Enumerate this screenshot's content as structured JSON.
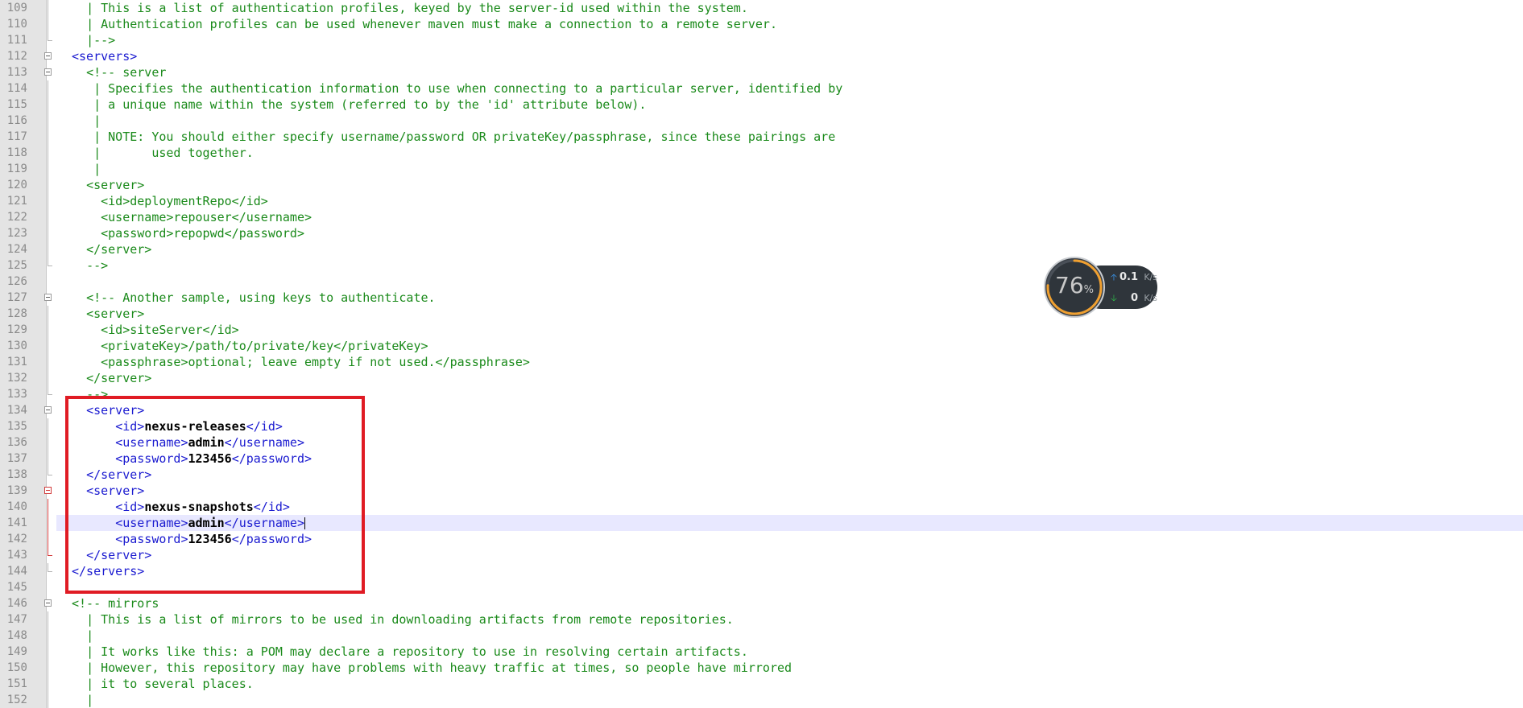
{
  "editor": {
    "current_line": 141,
    "lines": [
      {
        "n": "109",
        "indent": "  ",
        "parts": [
          {
            "t": "| This is a list of authentication profiles, keyed by the server-id used within the system.",
            "c": "cm"
          }
        ]
      },
      {
        "n": "110",
        "indent": "  ",
        "parts": [
          {
            "t": "| Authentication profiles can be used whenever maven must make a connection to a remote server.",
            "c": "cm"
          }
        ]
      },
      {
        "n": "111",
        "indent": "  ",
        "parts": [
          {
            "t": "|-->",
            "c": "cm"
          }
        ]
      },
      {
        "n": "112",
        "indent": "",
        "parts": [
          {
            "t": "<servers>",
            "c": "tg"
          }
        ]
      },
      {
        "n": "113",
        "indent": "  ",
        "parts": [
          {
            "t": "<!-- server",
            "c": "cm"
          }
        ]
      },
      {
        "n": "114",
        "indent": "   ",
        "parts": [
          {
            "t": "| Specifies the authentication information to use when connecting to a particular server, identified by",
            "c": "cm"
          }
        ]
      },
      {
        "n": "115",
        "indent": "   ",
        "parts": [
          {
            "t": "| a unique name within the system (referred to by the 'id' attribute below).",
            "c": "cm"
          }
        ]
      },
      {
        "n": "116",
        "indent": "   ",
        "parts": [
          {
            "t": "|",
            "c": "cm"
          }
        ]
      },
      {
        "n": "117",
        "indent": "   ",
        "parts": [
          {
            "t": "| NOTE: You should either specify username/password OR privateKey/passphrase, since these pairings are",
            "c": "cm"
          }
        ]
      },
      {
        "n": "118",
        "indent": "   ",
        "parts": [
          {
            "t": "|       used together.",
            "c": "cm"
          }
        ]
      },
      {
        "n": "119",
        "indent": "   ",
        "parts": [
          {
            "t": "|",
            "c": "cm"
          }
        ]
      },
      {
        "n": "120",
        "indent": "  ",
        "parts": [
          {
            "t": "<server>",
            "c": "cm"
          }
        ]
      },
      {
        "n": "121",
        "indent": "    ",
        "parts": [
          {
            "t": "<id>deploymentRepo</id>",
            "c": "cm"
          }
        ]
      },
      {
        "n": "122",
        "indent": "    ",
        "parts": [
          {
            "t": "<username>repouser</username>",
            "c": "cm"
          }
        ]
      },
      {
        "n": "123",
        "indent": "    ",
        "parts": [
          {
            "t": "<password>repopwd</password>",
            "c": "cm"
          }
        ]
      },
      {
        "n": "124",
        "indent": "  ",
        "parts": [
          {
            "t": "</server>",
            "c": "cm"
          }
        ]
      },
      {
        "n": "125",
        "indent": "  ",
        "parts": [
          {
            "t": "-->",
            "c": "cm"
          }
        ]
      },
      {
        "n": "126",
        "indent": "",
        "parts": []
      },
      {
        "n": "127",
        "indent": "  ",
        "parts": [
          {
            "t": "<!-- Another sample, using keys to authenticate.",
            "c": "cm"
          }
        ]
      },
      {
        "n": "128",
        "indent": "  ",
        "parts": [
          {
            "t": "<server>",
            "c": "cm"
          }
        ]
      },
      {
        "n": "129",
        "indent": "    ",
        "parts": [
          {
            "t": "<id>siteServer</id>",
            "c": "cm"
          }
        ]
      },
      {
        "n": "130",
        "indent": "    ",
        "parts": [
          {
            "t": "<privateKey>/path/to/private/key</privateKey>",
            "c": "cm"
          }
        ]
      },
      {
        "n": "131",
        "indent": "    ",
        "parts": [
          {
            "t": "<passphrase>optional; leave empty if not used.</passphrase>",
            "c": "cm"
          }
        ]
      },
      {
        "n": "132",
        "indent": "  ",
        "parts": [
          {
            "t": "</server>",
            "c": "cm"
          }
        ]
      },
      {
        "n": "133",
        "indent": "  ",
        "parts": [
          {
            "t": "-->",
            "c": "cm"
          }
        ]
      },
      {
        "n": "134",
        "indent": "  ",
        "parts": [
          {
            "t": "<server>",
            "c": "tg"
          }
        ]
      },
      {
        "n": "135",
        "indent": "      ",
        "parts": [
          {
            "t": "<id>",
            "c": "tg"
          },
          {
            "t": "nexus-releases",
            "c": "tx"
          },
          {
            "t": "</id>",
            "c": "tg"
          }
        ]
      },
      {
        "n": "136",
        "indent": "      ",
        "parts": [
          {
            "t": "<username>",
            "c": "tg"
          },
          {
            "t": "admin",
            "c": "tx"
          },
          {
            "t": "</username>",
            "c": "tg"
          }
        ]
      },
      {
        "n": "137",
        "indent": "      ",
        "parts": [
          {
            "t": "<password>",
            "c": "tg"
          },
          {
            "t": "123456",
            "c": "tx"
          },
          {
            "t": "</password>",
            "c": "tg"
          }
        ]
      },
      {
        "n": "138",
        "indent": "  ",
        "parts": [
          {
            "t": "</server>",
            "c": "tg"
          }
        ]
      },
      {
        "n": "139",
        "indent": "  ",
        "parts": [
          {
            "t": "<server>",
            "c": "tg"
          }
        ]
      },
      {
        "n": "140",
        "indent": "      ",
        "parts": [
          {
            "t": "<id>",
            "c": "tg"
          },
          {
            "t": "nexus-snapshots",
            "c": "tx"
          },
          {
            "t": "</id>",
            "c": "tg"
          }
        ]
      },
      {
        "n": "141",
        "indent": "      ",
        "parts": [
          {
            "t": "<username>",
            "c": "tg"
          },
          {
            "t": "admin",
            "c": "tx"
          },
          {
            "t": "</username>",
            "c": "tg"
          }
        ]
      },
      {
        "n": "142",
        "indent": "      ",
        "parts": [
          {
            "t": "<password>",
            "c": "tg"
          },
          {
            "t": "123456",
            "c": "tx"
          },
          {
            "t": "</password>",
            "c": "tg"
          }
        ]
      },
      {
        "n": "143",
        "indent": "  ",
        "parts": [
          {
            "t": "</server>",
            "c": "tg"
          }
        ]
      },
      {
        "n": "144",
        "indent": "",
        "parts": [
          {
            "t": "</servers>",
            "c": "tg"
          }
        ]
      },
      {
        "n": "145",
        "indent": "",
        "parts": []
      },
      {
        "n": "146",
        "indent": "",
        "parts": [
          {
            "t": "<!-- mirrors",
            "c": "cm"
          }
        ]
      },
      {
        "n": "147",
        "indent": "  ",
        "parts": [
          {
            "t": "| This is a list of mirrors to be used in downloading artifacts from remote repositories.",
            "c": "cm"
          }
        ]
      },
      {
        "n": "148",
        "indent": "  ",
        "parts": [
          {
            "t": "|",
            "c": "cm"
          }
        ]
      },
      {
        "n": "149",
        "indent": "  ",
        "parts": [
          {
            "t": "| It works like this: a POM may declare a repository to use in resolving certain artifacts.",
            "c": "cm"
          }
        ]
      },
      {
        "n": "150",
        "indent": "  ",
        "parts": [
          {
            "t": "| However, this repository may have problems with heavy traffic at times, so people have mirrored",
            "c": "cm"
          }
        ]
      },
      {
        "n": "151",
        "indent": "  ",
        "parts": [
          {
            "t": "| it to several places.",
            "c": "cm"
          }
        ]
      },
      {
        "n": "152",
        "indent": "  ",
        "parts": [
          {
            "t": "|",
            "c": "cm"
          }
        ]
      }
    ],
    "fold_markers": {
      "112": "box",
      "113": "box",
      "127": "box",
      "134": "box",
      "139": "box-red",
      "146": "box",
      "111": "end",
      "125": "end",
      "133": "end",
      "138": "end",
      "143": "end-red",
      "144": "end"
    }
  },
  "net_widget": {
    "cpu_percent": "76",
    "cpu_unit": "%",
    "cpu_level": 0.76,
    "upload_value": "0.1",
    "upload_unit": "K/s",
    "download_value": "0",
    "download_unit": "K/s",
    "colors": {
      "ring_track": "#3a3f45",
      "ring_fill": "#f0a030",
      "ring_fill2": "#39c0c8"
    }
  },
  "colors": {
    "comment": "#1a8a1a",
    "tag": "#1a1ad0",
    "text": "#000000",
    "highlight_border": "#e01b24",
    "current_line_bg": "#e8e8ff"
  }
}
